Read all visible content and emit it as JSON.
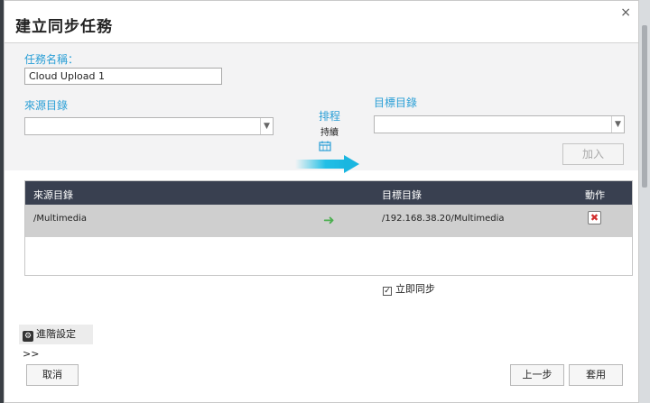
{
  "dialog": {
    "title": "建立同步任務",
    "close_glyph": "×"
  },
  "task_name": {
    "label": "任務名稱：",
    "value": "Cloud Upload 1"
  },
  "source": {
    "label": "來源目錄",
    "value": ""
  },
  "target": {
    "label": "目標目錄",
    "value": ""
  },
  "schedule": {
    "label": "排程",
    "status": "持續"
  },
  "add_button": "加入",
  "table": {
    "columns": [
      "來源目錄",
      "目標目錄",
      "動作"
    ],
    "rows": [
      {
        "source": "/Multimedia",
        "target": "/192.168.38.20/Multimedia"
      }
    ]
  },
  "sync_now": {
    "checked": true,
    "label": "立即同步"
  },
  "advanced": {
    "label": "進階設定",
    "chevron": ">>"
  },
  "buttons": {
    "cancel": "取消",
    "previous": "上一步",
    "apply": "套用"
  },
  "icons": {
    "close": "close-icon",
    "dropdown": "chevron-down-icon",
    "calendar": "calendar-icon",
    "arrow": "arrow-right-icon",
    "delete": "delete-icon",
    "gear": "gear-icon",
    "checkbox": "checkbox-checked-icon"
  },
  "colors": {
    "accent": "#2a9fd6",
    "table_header": "#394050",
    "row_highlight": "#cfcfcf",
    "arrow_green": "#4caf50",
    "delete_red": "#d32f2f"
  }
}
